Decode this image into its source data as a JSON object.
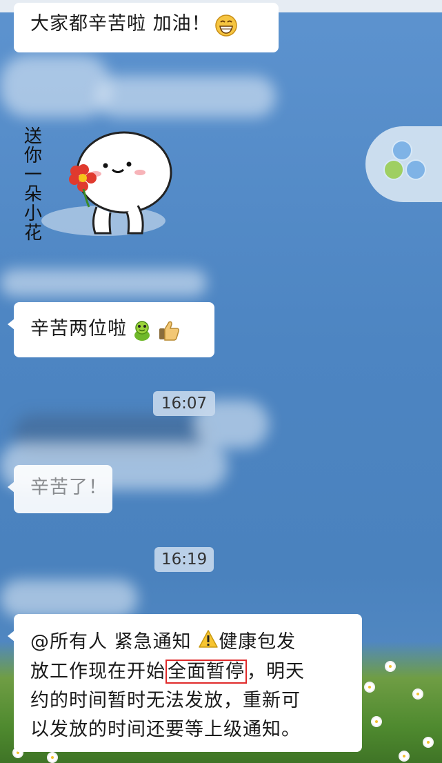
{
  "messages": {
    "m1_text": "大家都辛苦啦 加油！",
    "sticker_caption": "送你一朵小花",
    "m2_text": "辛苦两位啦",
    "time1": "16:07",
    "m3_text": "辛苦了！",
    "time2": "16:19",
    "notice_line1": "@所有人 紧急通知",
    "notice_line1b": "健康包发",
    "notice_line2a": "放工作现在开始",
    "notice_highlight": "全面暂停",
    "notice_line2b": "，明天",
    "notice_line3": "约的时间暂时无法发放，重新可",
    "notice_line4": "以发放的时间还要等上级通知。"
  },
  "icons": {
    "grin": "grinning-face-icon",
    "frog": "green-frog-icon",
    "thumb": "thumbs-up-icon",
    "warning": "warning-icon"
  },
  "colors": {
    "chat_bg": "#4f87c4",
    "bubble": "#ffffff",
    "highlight_border": "#e02a2a"
  }
}
